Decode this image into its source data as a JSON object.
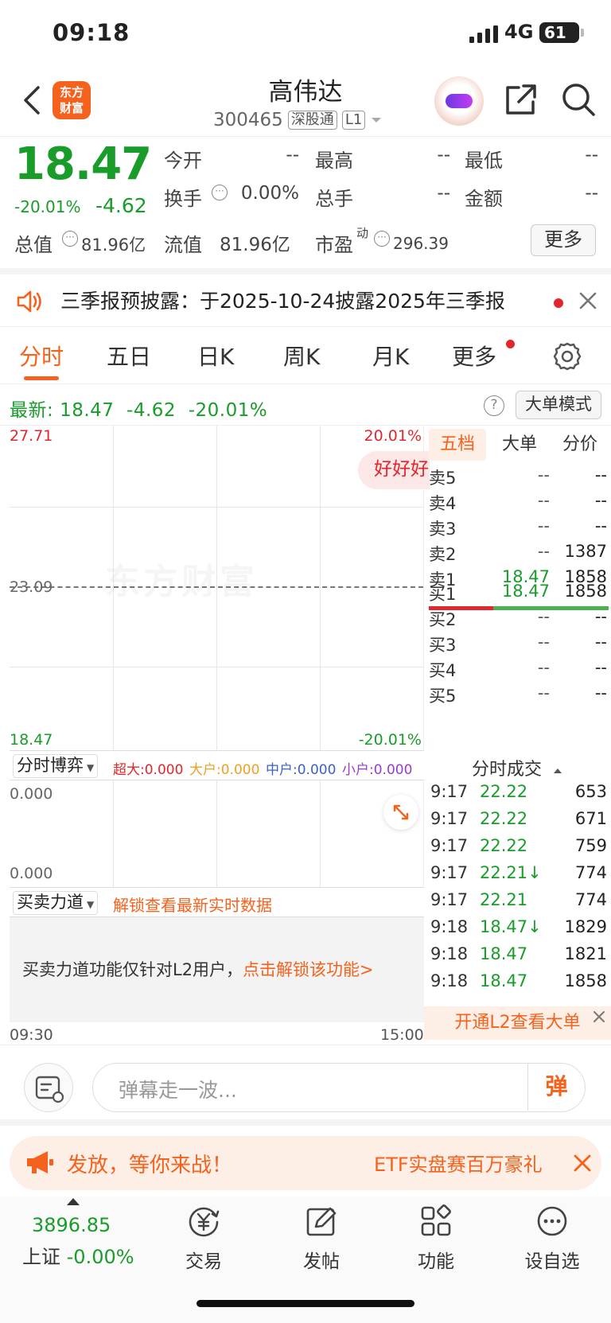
{
  "status_bar": {
    "time": "09:18",
    "network": "4G",
    "battery": "61"
  },
  "header": {
    "logo_line1": "东方",
    "logo_line2": "财富",
    "stock_name": "高伟达",
    "stock_code": "300465",
    "tag_connect": "深股通",
    "tag_level": "L1"
  },
  "quote": {
    "price": "18.47",
    "change_pct": "-20.01%",
    "change_val": "-4.62",
    "open_label": "今开",
    "open_val": "--",
    "high_label": "最高",
    "high_val": "--",
    "low_label": "最低",
    "low_val": "--",
    "turnover_label": "换手",
    "turnover_val": "0.00%",
    "volume_label": "总手",
    "volume_val": "--",
    "amount_label": "金额",
    "amount_val": "--",
    "mktcap_label": "总值",
    "mktcap_val": "81.96亿",
    "float_label": "流值",
    "float_val": "81.96亿",
    "pe_label": "市盈",
    "pe_sup": "动",
    "pe_val": "296.39",
    "more_label": "更多"
  },
  "notice": {
    "text": "三季报预披露：于2025-10-24披露2025年三季报"
  },
  "tabs": [
    {
      "label": "分时"
    },
    {
      "label": "五日"
    },
    {
      "label": "日K"
    },
    {
      "label": "周K"
    },
    {
      "label": "月K"
    },
    {
      "label": "更多"
    }
  ],
  "latest": {
    "label": "最新:",
    "price": "18.47",
    "change": "-4.62",
    "pct": "-20.01%",
    "help": "?",
    "mode_label": "大单模式"
  },
  "chart": {
    "y_top": "27.71",
    "y_mid": "23.09",
    "y_bottom": "18.47",
    "pct_top": "20.01%",
    "pct_bottom": "-20.01%",
    "watermark": "东方财富",
    "bubble": "好好好"
  },
  "indicator": {
    "select_label": "分时博弈",
    "super_label": "超大:0.000",
    "large_label": "大户:0.000",
    "mid_label": "中户:0.000",
    "small_label": "小户:0.000",
    "sub_top": "0.000",
    "sub_bottom": "0.000"
  },
  "force": {
    "select_label": "买卖力道",
    "unlock_text": "解锁查看最新实时数据",
    "l2_text": "买卖力道功能仅针对L2用户，",
    "l2_link": "点击解锁该功能>",
    "time_start": "09:30",
    "time_end": "15:00"
  },
  "book": {
    "tabs": [
      "五档",
      "大单",
      "分价"
    ],
    "asks": [
      {
        "label": "卖5",
        "price": "--",
        "vol": "--"
      },
      {
        "label": "卖4",
        "price": "--",
        "vol": "--"
      },
      {
        "label": "卖3",
        "price": "--",
        "vol": "--"
      },
      {
        "label": "卖2",
        "price": "--",
        "vol": "1387"
      },
      {
        "label": "卖1",
        "price": "18.47",
        "vol": "1858"
      }
    ],
    "bids": [
      {
        "label": "买1",
        "price": "18.47",
        "vol": "1858"
      },
      {
        "label": "买2",
        "price": "--",
        "vol": "--"
      },
      {
        "label": "买3",
        "price": "--",
        "vol": "--"
      },
      {
        "label": "买4",
        "price": "--",
        "vol": "--"
      },
      {
        "label": "买5",
        "price": "--",
        "vol": "--"
      }
    ],
    "sell_ratio": 0.36
  },
  "trades": {
    "title": "分时成交",
    "rows": [
      {
        "time": "9:17",
        "price": "22.22",
        "vol": "653"
      },
      {
        "time": "9:17",
        "price": "22.22",
        "vol": "671"
      },
      {
        "time": "9:17",
        "price": "22.22",
        "vol": "759"
      },
      {
        "time": "9:17",
        "price": "22.21↓",
        "vol": "774"
      },
      {
        "time": "9:17",
        "price": "22.21",
        "vol": "774"
      },
      {
        "time": "9:18",
        "price": "18.47↓",
        "vol": "1829"
      },
      {
        "time": "9:18",
        "price": "18.47",
        "vol": "1821"
      },
      {
        "time": "9:18",
        "price": "18.47",
        "vol": "1858"
      }
    ],
    "l2_label": "开通L2查看大单"
  },
  "danmaku": {
    "placeholder": "弹幕走一波...",
    "send_label": "弹"
  },
  "promo": {
    "text": "发放，等你来战！",
    "text2": "ETF实盘赛百万豪礼"
  },
  "nav": {
    "index_value": "3896.85",
    "index_name": "上证",
    "index_pct": "-0.00%",
    "items": [
      {
        "label": "交易"
      },
      {
        "label": "发帖"
      },
      {
        "label": "功能"
      },
      {
        "label": "设自选"
      }
    ]
  },
  "colors": {
    "up": "#e3262c",
    "down": "#1a9c2b",
    "accent": "#f5621d"
  }
}
